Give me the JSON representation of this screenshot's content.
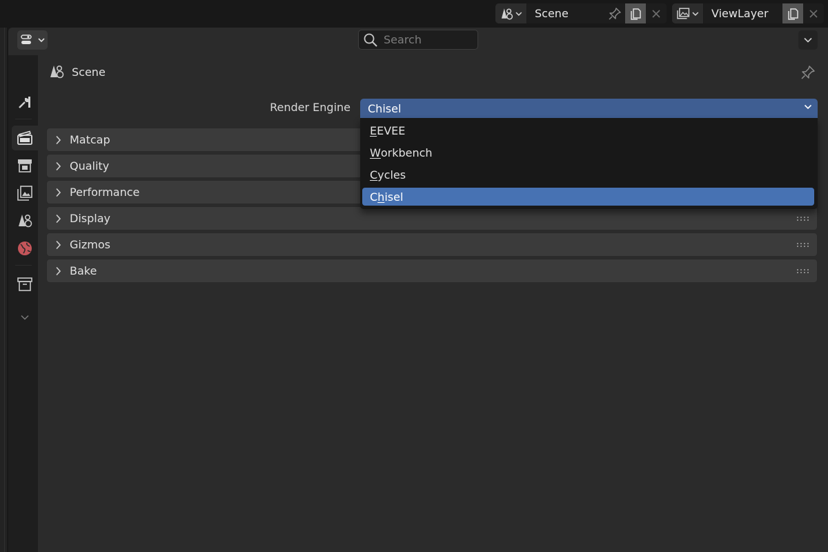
{
  "header": {
    "scene_name": "Scene",
    "view_layer_name": "ViewLayer"
  },
  "editor_header": {
    "search_placeholder": "Search"
  },
  "context": {
    "label": "Scene"
  },
  "render_engine": {
    "label": "Render Engine",
    "value": "Chisel"
  },
  "panels": [
    {
      "title": "Matcap"
    },
    {
      "title": "Quality"
    },
    {
      "title": "Performance"
    },
    {
      "title": "Display"
    },
    {
      "title": "Gizmos"
    },
    {
      "title": "Bake"
    }
  ],
  "menu": {
    "items": [
      {
        "pre": "",
        "ul": "E",
        "post": "EVEE",
        "selected": false
      },
      {
        "pre": "",
        "ul": "W",
        "post": "orkbench",
        "selected": false
      },
      {
        "pre": "",
        "ul": "C",
        "post": "ycles",
        "selected": false
      },
      {
        "pre": "C",
        "ul": "h",
        "post": "isel",
        "selected": true
      }
    ]
  },
  "colors": {
    "accent_selected": "#4772b3",
    "select_field": "#3f5e92",
    "world_icon": "#c4555a"
  }
}
